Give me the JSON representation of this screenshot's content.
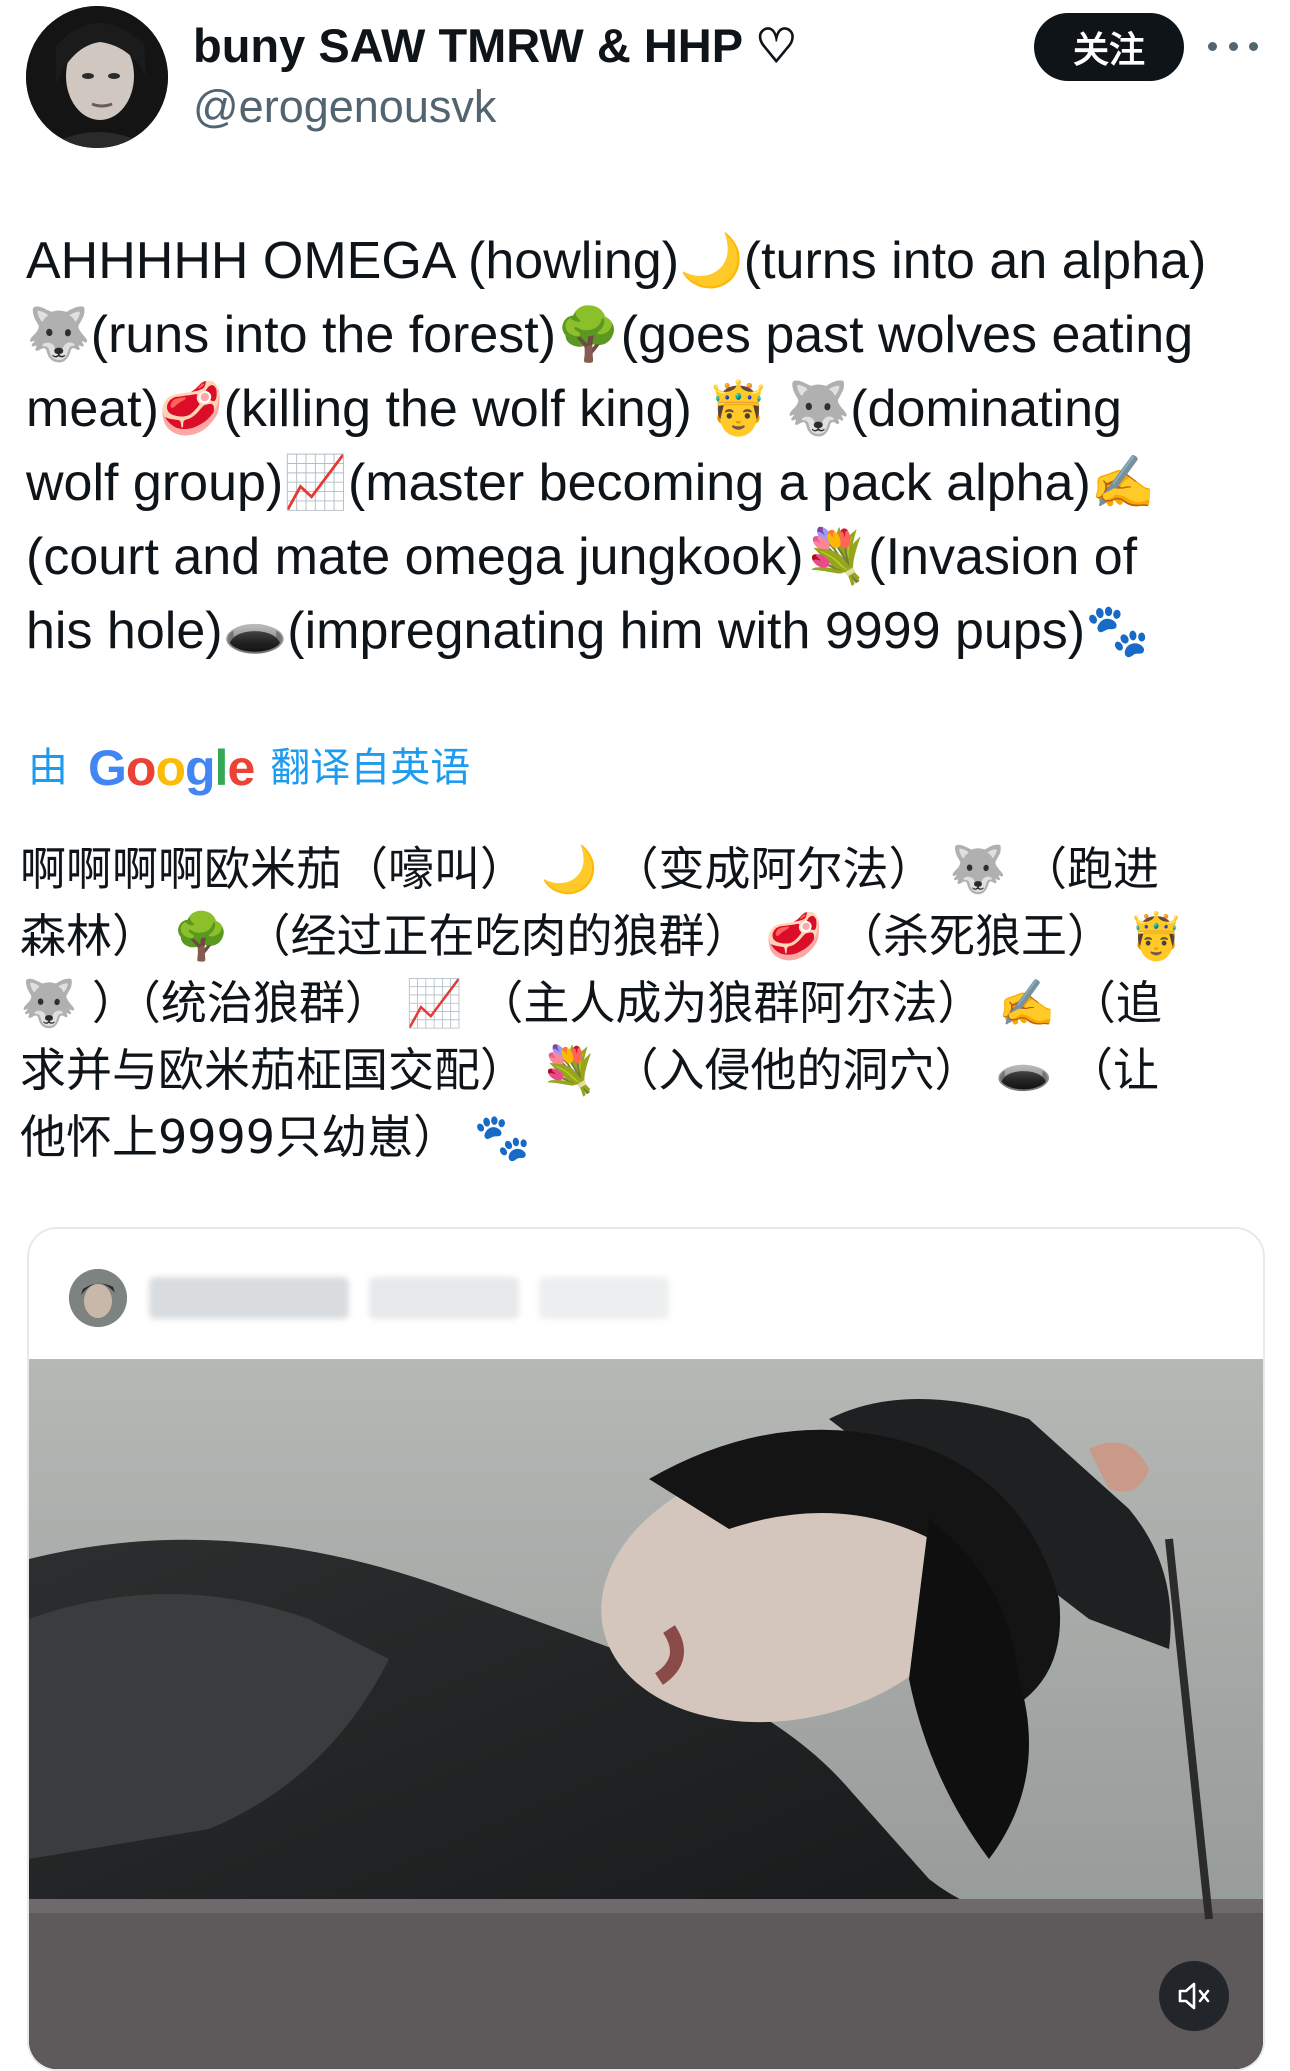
{
  "author": {
    "display_name": "buny SAW TMRW & HHP ♡",
    "handle": "@erogenousvk"
  },
  "header": {
    "follow_label": "关注",
    "more_icon": "more-horizontal-icon"
  },
  "tweet": {
    "text": "AHHHHH OMEGA (howling)🌙(turns into an alpha)\n🐺(runs into the forest)🌳(goes past wolves eating\nmeat)🥩(killing the wolf king) 🤴 🐺(dominating\nwolf group)📈(master becoming a pack alpha)✍️\n(court and mate omega jungkook)💐(Invasion of\nhis hole)🕳️(impregnating him with 9999 pups)🐾"
  },
  "translation": {
    "by_label": "由",
    "provider": "Google",
    "from_label": "翻译自英语",
    "text": "啊啊啊啊欧米茄（嚎叫） 🌙 （变成阿尔法） 🐺 （跑进\n森林） 🌳 （经过正在吃肉的狼群） 🥩 （杀死狼王） 🤴\n🐺 ）（统治狼群） 📈 （主人成为狼群阿尔法） ✍️ （追\n求并与欧米茄柾国交配） 💐 （入侵他的洞穴） 🕳️ （让\n他怀上9999只幼崽） 🐾"
  },
  "quoted_post": {
    "media_kind": "video",
    "mute_icon": "volume-muted-icon"
  },
  "colors": {
    "accent": "#1d9bf0",
    "text": "#0f1419",
    "secondary": "#536471",
    "google_blue": "#4285f4",
    "google_red": "#ea4335",
    "google_yellow": "#fbbc05",
    "google_green": "#34a853"
  }
}
